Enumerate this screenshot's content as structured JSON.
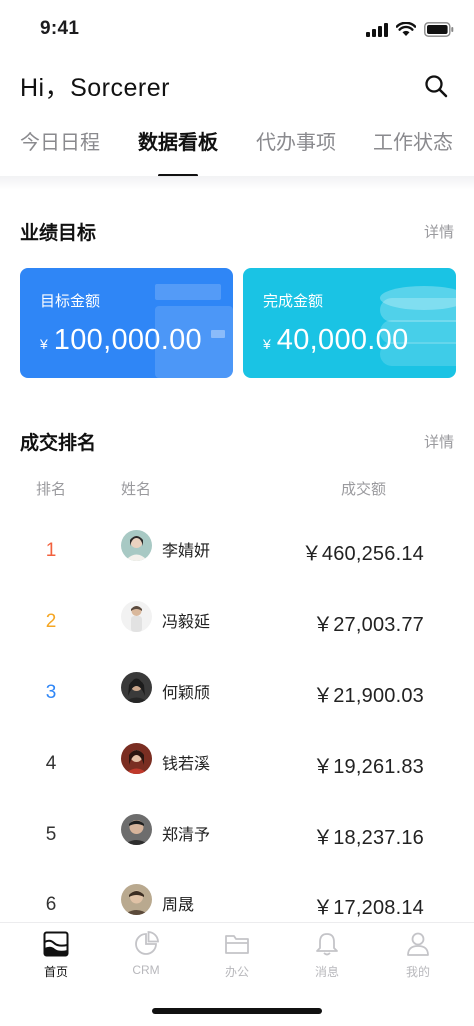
{
  "status_bar": {
    "time": "9:41"
  },
  "header": {
    "greeting": "Hi，Sorcerer",
    "search_icon": "search-icon"
  },
  "tabs": [
    {
      "label": "今日日程",
      "active": false
    },
    {
      "label": "数据看板",
      "active": true
    },
    {
      "label": "代办事项",
      "active": false
    },
    {
      "label": "工作状态",
      "active": false
    }
  ],
  "performance": {
    "title": "业绩目标",
    "detail_link": "详情",
    "cards": [
      {
        "label": "目标金额",
        "currency": "¥",
        "value": "100,000.00",
        "color": "#2f86f6"
      },
      {
        "label": "完成金额",
        "currency": "¥",
        "value": "40,000.00",
        "color": "#1ac3e4"
      }
    ]
  },
  "ranking": {
    "title": "成交排名",
    "detail_link": "详情",
    "columns": {
      "rank": "排名",
      "name": "姓名",
      "amount": "成交额"
    },
    "rows": [
      {
        "rank": "1",
        "name": "李婧妍",
        "amount": "￥460,256.14",
        "rank_color": "#f2603d"
      },
      {
        "rank": "2",
        "name": "冯毅延",
        "amount": "￥27,003.77",
        "rank_color": "#f5a623"
      },
      {
        "rank": "3",
        "name": "何颖颀",
        "amount": "￥21,900.03",
        "rank_color": "#2f86f6"
      },
      {
        "rank": "4",
        "name": "钱若溪",
        "amount": "￥19,261.83",
        "rank_color": "#333333"
      },
      {
        "rank": "5",
        "name": "郑清予",
        "amount": "￥18,237.16",
        "rank_color": "#333333"
      },
      {
        "rank": "6",
        "name": "周晟",
        "amount": "￥17,208.14",
        "rank_color": "#333333"
      }
    ]
  },
  "bottom_nav": [
    {
      "label": "首页",
      "icon": "dashboard-icon",
      "active": true
    },
    {
      "label": "CRM",
      "icon": "pie-chart-icon",
      "active": false
    },
    {
      "label": "办公",
      "icon": "folder-icon",
      "active": false
    },
    {
      "label": "消息",
      "icon": "bell-icon",
      "active": false
    },
    {
      "label": "我的",
      "icon": "user-icon",
      "active": false
    }
  ]
}
